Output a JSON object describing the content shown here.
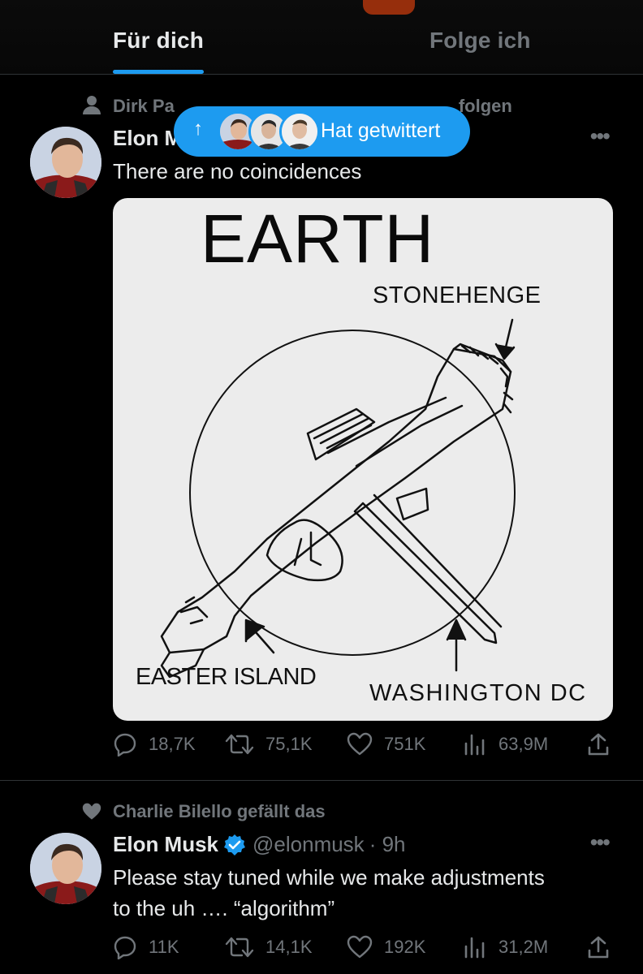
{
  "tabs": {
    "for_you": "Für dich",
    "following": "Folge ich"
  },
  "tweet1": {
    "social_context": "Dirk Pa… und Al… M… folgen",
    "social_context_visible_start": "Dirk Pa",
    "social_context_visible_end": "folgen",
    "author_name": "Elon M",
    "text": "There are no coincidences",
    "image": {
      "title": "EARTH",
      "label_stonehenge": "STONEHENGE",
      "label_easter_island": "EASTER ISLAND",
      "label_washington": "WASHINGTON DC"
    },
    "stats": {
      "replies": "18,7K",
      "retweets": "75,1K",
      "likes": "751K",
      "views": "63,9M"
    }
  },
  "retweet_pill": {
    "label": "Hat getwittert",
    "arrow": "↑"
  },
  "tweet2": {
    "social_context": "Charlie Bilello gefällt das",
    "author_name": "Elon Musk",
    "handle": "@elonmusk",
    "time": "· 9h",
    "text_line1": "Please stay tuned while we make adjustments",
    "text_line2": "to the uh …. “algorithm”",
    "stats": {
      "replies": "11K",
      "retweets": "14,1K",
      "likes": "192K",
      "views": "31,2M"
    }
  },
  "colors": {
    "accent": "#1d9bf0",
    "background": "#000000",
    "text_primary": "#e7e9ea",
    "text_secondary": "#71767b",
    "verified": "#1d9bf0"
  },
  "icons": [
    "person-icon",
    "heart-icon",
    "reply-icon",
    "retweet-icon",
    "like-icon",
    "views-icon",
    "share-icon",
    "verified-icon",
    "more-icon"
  ]
}
